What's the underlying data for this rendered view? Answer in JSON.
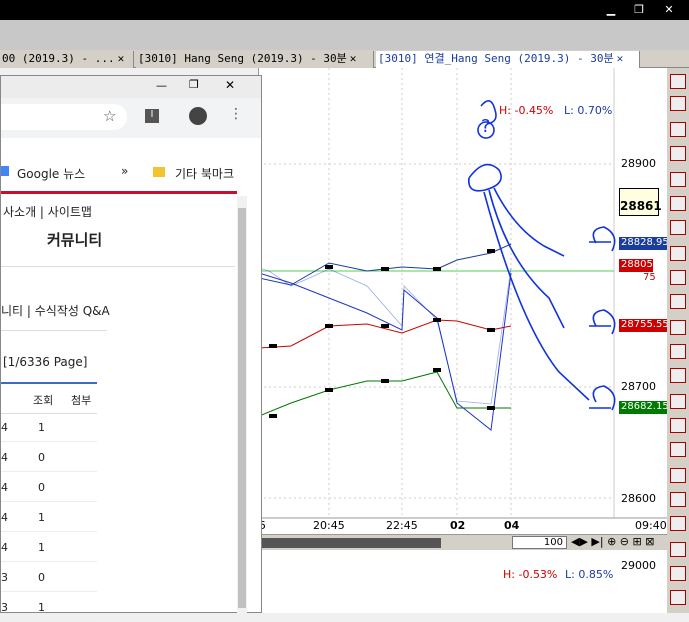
{
  "tabs": [
    {
      "label": "00 (2019.3) - ...",
      "active": false
    },
    {
      "label": "[3010] Hang Seng (2019.3) - 30분",
      "active": false
    },
    {
      "label": "[3010] 연결_Hang Seng (2019.3) - 30분",
      "active": true
    }
  ],
  "browser": {
    "bookmark_news": "Google 뉴스",
    "bookmark_more": "»",
    "bookmark_other": "기타 북마크",
    "nav_links": "사소개 | 사이트맵",
    "section_title": "커뮤니티",
    "sub_links": "니티 | 수식작성 Q&A",
    "page_info": "[1/6336 Page]",
    "columns": [
      "조회",
      "첨부"
    ],
    "rows": [
      {
        "a": "4",
        "v": "1"
      },
      {
        "a": "4",
        "v": "0"
      },
      {
        "a": "4",
        "v": "0"
      },
      {
        "a": "4",
        "v": "1"
      },
      {
        "a": "4",
        "v": "1"
      },
      {
        "a": "3",
        "v": "0"
      },
      {
        "a": "3",
        "v": "1"
      }
    ]
  },
  "chart": {
    "h_label": "H: -0.45%",
    "l_label": "L: 0.70%",
    "h_label2": "H: -0.53%",
    "l_label2": "L: 0.85%",
    "yticks": [
      "28900",
      "28700",
      "28600"
    ],
    "ytick2": "29000",
    "xticks": [
      "5",
      "20:45",
      "22:45",
      "02",
      "04",
      "09:40"
    ],
    "current_price": "28861",
    "price_blue": "28828.95",
    "price_red": "28805",
    "price_red_sub": "75",
    "price_red2": "28755.55",
    "price_green": "28682.15",
    "scroll_value": "100",
    "annotation": "?"
  },
  "colors": {
    "accent_blue": "#1a3c9c",
    "red": "#cc0000",
    "green": "#007a00"
  }
}
